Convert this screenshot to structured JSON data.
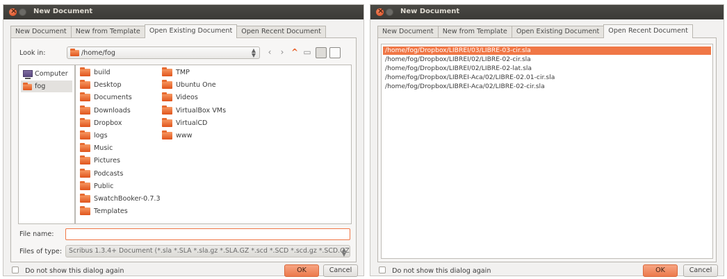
{
  "colors": {
    "accent": "#f07746",
    "titlebar": "#3c3b37",
    "window_bg": "#f2f1f0"
  },
  "dialog1": {
    "title": "New Document",
    "tabs": [
      {
        "label": "New Document",
        "active": false
      },
      {
        "label": "New from Template",
        "active": false
      },
      {
        "label": "Open Existing Document",
        "active": true
      },
      {
        "label": "Open Recent Document",
        "active": false
      }
    ],
    "look_in_label": "Look in:",
    "look_in_value": "/home/fog",
    "places": [
      {
        "label": "Computer",
        "icon": "computer-icon"
      },
      {
        "label": "fog",
        "icon": "home-folder-icon"
      }
    ],
    "files_col1": [
      "build",
      "Desktop",
      "Documents",
      "Downloads",
      "Dropbox",
      "logs",
      "Music",
      "Pictures",
      "Podcasts",
      "Public",
      "SwatchBooker-0.7.3",
      "Templates"
    ],
    "files_col2": [
      "TMP",
      "Ubuntu One",
      "Videos",
      "VirtualBox VMs",
      "VirtualCD",
      "www"
    ],
    "file_name_label": "File name:",
    "file_name_value": "",
    "files_of_type_label": "Files of type:",
    "files_of_type_value": "Scribus 1.3.4+ Document (*.sla *.SLA *.sla.gz *.SLA.GZ *.scd *.SCD *.scd.gz *.SCD.GZ)",
    "checkbox_label": "Do not show this dialog again",
    "ok_label": "OK",
    "cancel_label": "Cancel"
  },
  "dialog2": {
    "title": "New Document",
    "tabs": [
      {
        "label": "New Document",
        "active": false
      },
      {
        "label": "New from Template",
        "active": false
      },
      {
        "label": "Open Existing Document",
        "active": false
      },
      {
        "label": "Open Recent Document",
        "active": true
      }
    ],
    "recent_files": [
      "/home/fog/Dropbox/LIBREI/03/LIBRE-03-cir.sla",
      "/home/fog/Dropbox/LIBREI/02/LIBRE-02-cir.sla",
      "/home/fog/Dropbox/LIBREI/02/LIBRE-02-lat.sla",
      "/home/fog/Dropbox/LIBREI-Aca/02/LIBRE-02.01-cir.sla",
      "/home/fog/Dropbox/LIBREI-Aca/02/LIBRE-02-cir.sla"
    ],
    "selected_index": 0,
    "checkbox_label": "Do not show this dialog again",
    "ok_label": "OK",
    "cancel_label": "Cancel"
  }
}
